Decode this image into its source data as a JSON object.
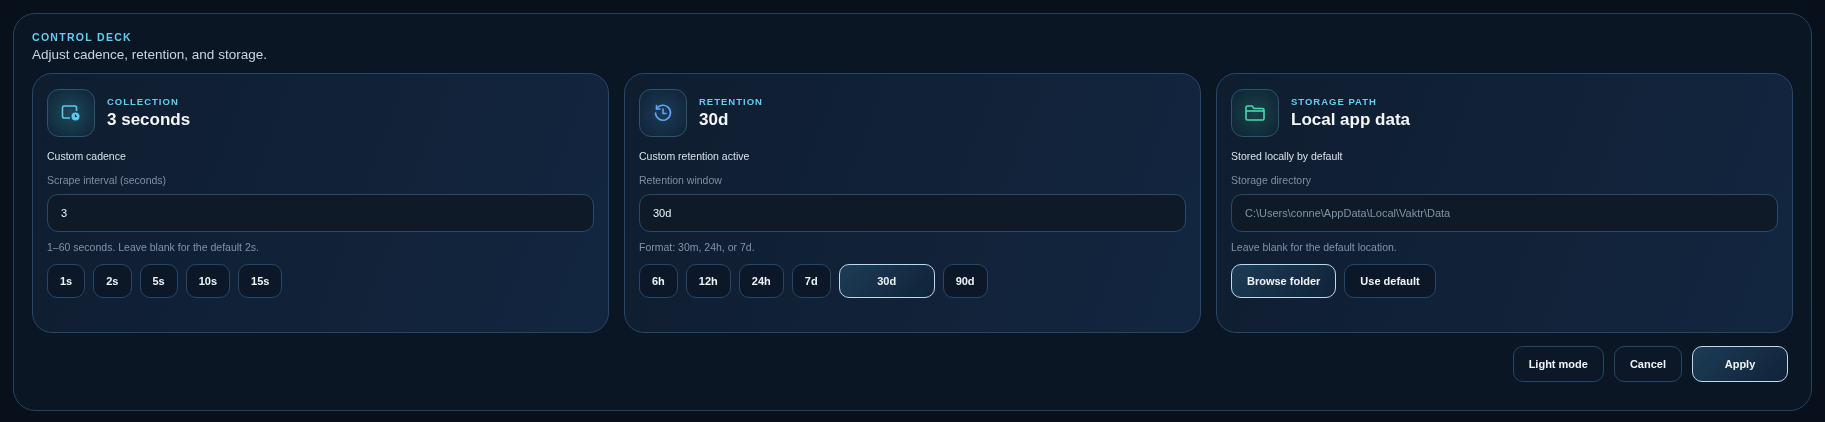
{
  "panel": {
    "eyebrow": "CONTROL DECK",
    "subtitle": "Adjust cadence, retention, and storage."
  },
  "cards": [
    {
      "eyebrow": "COLLECTION",
      "title": "3 seconds",
      "status": "Custom cadence",
      "field_label": "Scrape interval (seconds)",
      "field": {
        "value": "3"
      },
      "hint": "1–60 seconds. Leave blank for the default 2s.",
      "buttons": [
        {
          "label": "1s",
          "selected": false
        },
        {
          "label": "2s",
          "selected": false
        },
        {
          "label": "5s",
          "selected": false
        },
        {
          "label": "10s",
          "selected": false
        },
        {
          "label": "15s",
          "selected": false
        }
      ]
    },
    {
      "eyebrow": "RETENTION",
      "title": "30d",
      "status": "Custom retention active",
      "field_label": "Retention window",
      "field": {
        "value": "30d"
      },
      "hint": "Format: 30m, 24h, or 7d.",
      "buttons": [
        {
          "label": "6h",
          "selected": false
        },
        {
          "label": "12h",
          "selected": false
        },
        {
          "label": "24h",
          "selected": false
        },
        {
          "label": "7d",
          "selected": false
        },
        {
          "label": "30d",
          "selected": true
        },
        {
          "label": "90d",
          "selected": false
        }
      ]
    },
    {
      "eyebrow": "STORAGE PATH",
      "title": "Local app data",
      "status": "Stored locally by default",
      "field_label": "Storage directory",
      "field": {
        "placeholder": "C:\\Users\\conne\\AppData\\Local\\Vaktr\\Data"
      },
      "hint": "Leave blank for the default location.",
      "buttons": [
        {
          "label": "Browse folder",
          "selected": true
        },
        {
          "label": "Use default",
          "selected": false
        }
      ]
    }
  ],
  "footer": [
    {
      "label": "Light mode",
      "selected": false
    },
    {
      "label": "Cancel",
      "selected": false
    },
    {
      "label": "Apply",
      "selected": true
    }
  ]
}
